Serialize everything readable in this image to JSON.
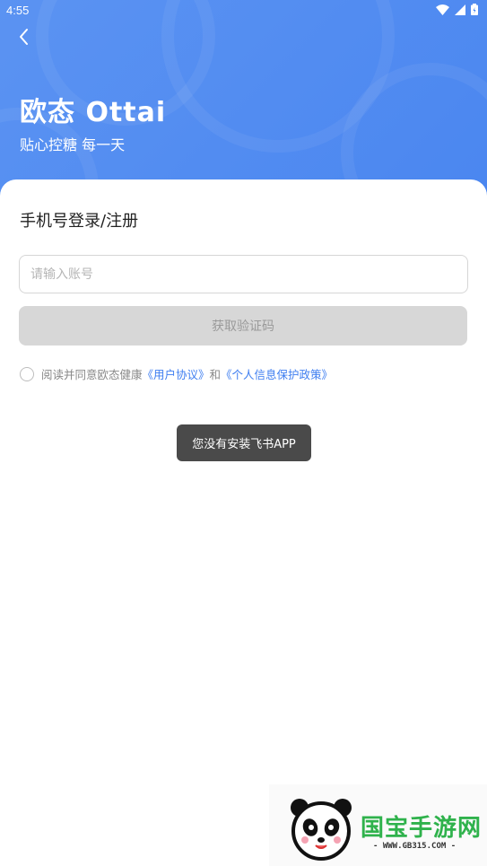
{
  "status_bar": {
    "time": "4:55"
  },
  "header": {
    "brand_title": "欧态 Ottai",
    "brand_subtitle": "贴心控糖 每一天"
  },
  "login": {
    "title": "手机号登录/注册",
    "account_placeholder": "请输入账号",
    "account_value": "",
    "get_code_label": "获取验证码",
    "agreement_prefix": "阅读并同意欧态健康",
    "user_agreement_link": "《用户协议》",
    "agreement_and": "和",
    "privacy_policy_link": "《个人信息保护政策》"
  },
  "toast": {
    "message": "您没有安装飞书APP"
  },
  "watermark": {
    "brand": "国宝手游网",
    "url": "- WWW.GB315.COM -"
  },
  "colors": {
    "header_blue": "#4a86f0",
    "link_blue": "#3d7df0",
    "button_disabled": "#d7d7d7",
    "toast_bg": "#4a4a4a",
    "watermark_green": "#2fb24c"
  },
  "icons": {
    "back": "chevron-left-icon",
    "wifi": "wifi-icon",
    "signal": "signal-icon",
    "battery": "battery-icon"
  }
}
